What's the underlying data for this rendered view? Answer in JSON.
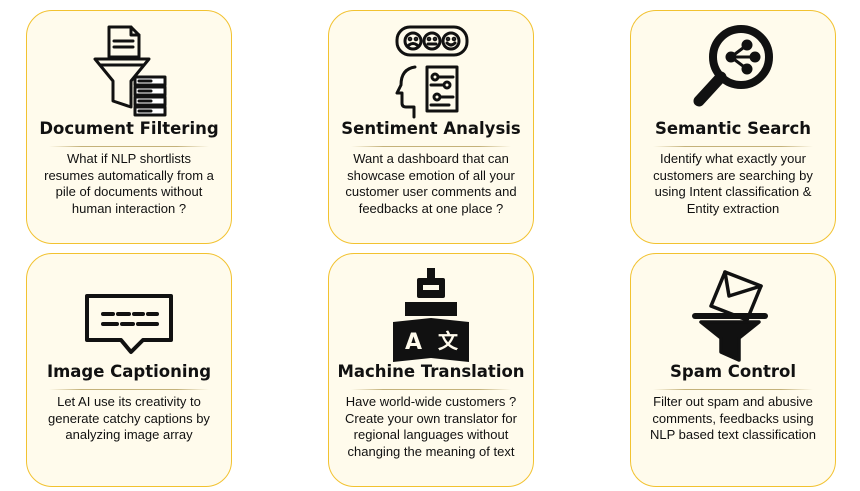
{
  "cards": [
    {
      "title": "Document  Filtering",
      "icon": "funnel-documents-icon",
      "lines": [
        "What if NLP shortlists",
        "resumes automatically from a",
        "pile of documents without",
        "human interaction ?"
      ]
    },
    {
      "title": "Sentiment Analysis",
      "icon": "emotion-head-icon",
      "lines": [
        "Want a dashboard that can",
        "showcase emotion of all your",
        "customer user comments and",
        "feedbacks at one place ?"
      ]
    },
    {
      "title": "Semantic Search",
      "icon": "magnifier-network-icon",
      "lines": [
        "Identify what exactly your",
        "customers are searching by",
        "using Intent classification &",
        "Entity extraction"
      ]
    },
    {
      "title": "Image Captioning",
      "icon": "caption-speech-bubble-icon",
      "lines": [
        "Let AI use its creativity to",
        "generate catchy captions by",
        "analyzing image array"
      ]
    },
    {
      "title": "Machine Translation",
      "icon": "robot-translate-icon",
      "lines": [
        "Have world-wide customers ?",
        "Create your own translator for",
        "regional languages without",
        "changing the meaning of text"
      ]
    },
    {
      "title": "Spam Control",
      "icon": "envelope-filter-icon",
      "lines": [
        "Filter out spam and abusive",
        "comments, feedbacks using",
        "NLP based text classification"
      ]
    }
  ],
  "icon_glyphs": {
    "translate_left": "A",
    "translate_right": "文"
  },
  "colors": {
    "card_background": "#fffbec",
    "card_border": "#f2c230",
    "text": "#111111"
  }
}
